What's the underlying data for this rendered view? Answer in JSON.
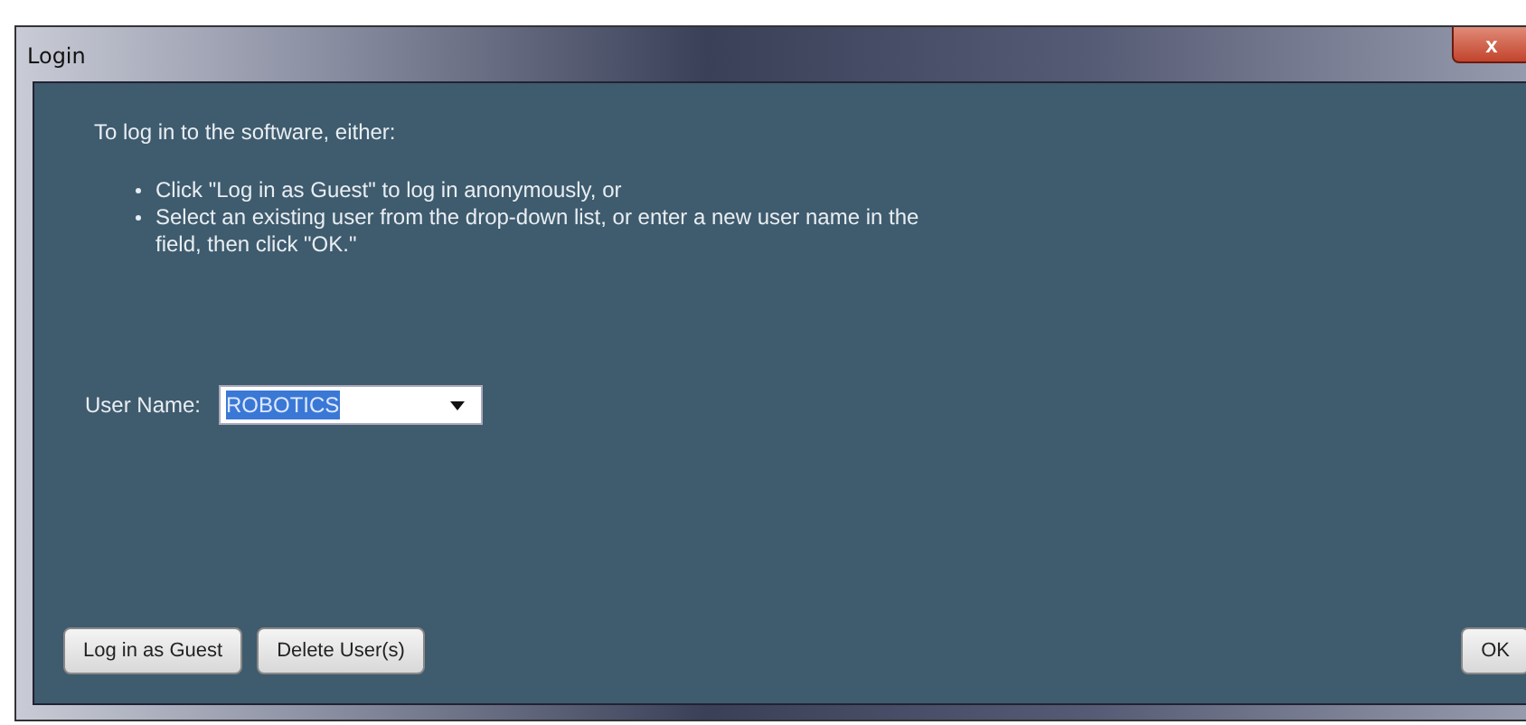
{
  "window": {
    "title": "Login",
    "close": "x"
  },
  "intro": "To log in to the software, either:",
  "bullets": [
    "Click \"Log in as Guest\" to log in anonymously, or",
    "Select an existing user from the drop-down list, or enter a new user name in the field, then click \"OK.\""
  ],
  "user_name": {
    "label": "User Name:",
    "value": "ROBOTICS",
    "value_selected": true
  },
  "buttons": [
    {
      "label": "Log in as Guest",
      "kind": "left"
    },
    {
      "label": "Delete User(s)",
      "kind": "left"
    },
    {
      "label": "OK",
      "kind": "right"
    }
  ]
}
